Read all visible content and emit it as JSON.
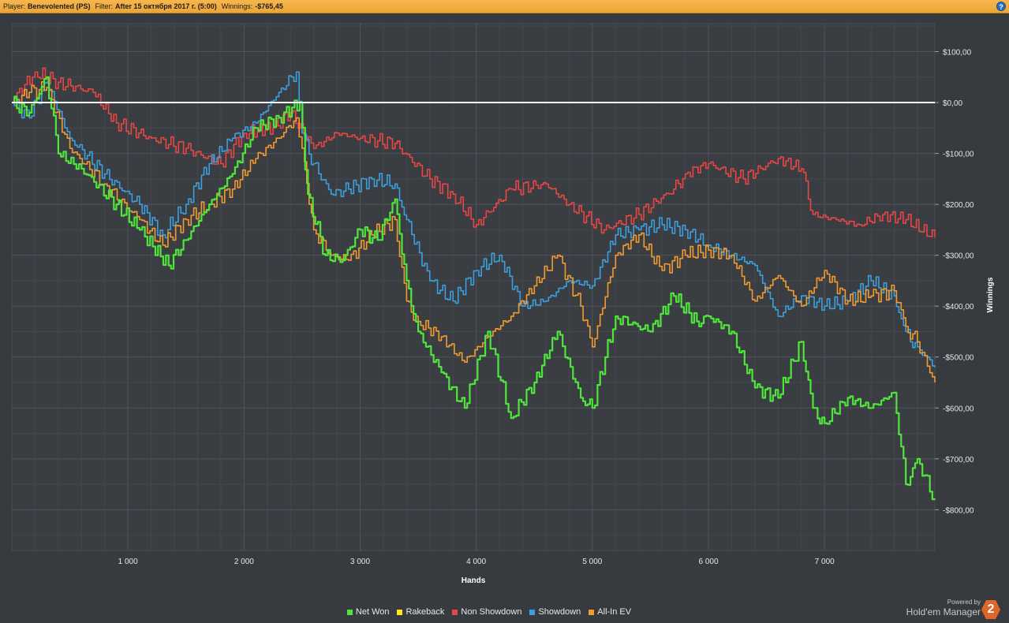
{
  "header": {
    "player_label": "Player:",
    "player_value": "Benevolented (PS)",
    "filter_label": "Filter:",
    "filter_value": "After 15 октября 2017 г. (5:00)",
    "winnings_label": "Winnings:",
    "winnings_value": "-$765,45",
    "help_glyph": "?"
  },
  "chart_data": {
    "type": "line",
    "xlabel": "Hands",
    "ylabel": "Winnings",
    "xlim": [
      0,
      7950
    ],
    "ylim": [
      -880,
      155
    ],
    "x_ticks": [
      1000,
      2000,
      3000,
      4000,
      5000,
      6000,
      7000
    ],
    "x_tick_labels": [
      "1 000",
      "2 000",
      "3 000",
      "4 000",
      "5 000",
      "6 000",
      "7 000"
    ],
    "y_ticks": [
      100,
      0,
      -100,
      -200,
      -300,
      -400,
      -500,
      -600,
      -700,
      -800
    ],
    "y_tick_labels": [
      "$100,00",
      "$0,00",
      "-$100,00",
      "-$200,00",
      "-$300,00",
      "-$400,00",
      "-$500,00",
      "-$600,00",
      "-$700,00",
      "-$800,00"
    ],
    "grid": true,
    "zero_line": true,
    "legend_position": "bottom",
    "series": [
      {
        "name": "Net Won",
        "color": "#4ee63a",
        "x": [
          0,
          150,
          300,
          400,
          600,
          900,
          1100,
          1350,
          1500,
          1700,
          1900,
          2100,
          2300,
          2480,
          2550,
          2700,
          2850,
          3000,
          3150,
          3300,
          3400,
          3500,
          3700,
          3900,
          4100,
          4300,
          4500,
          4700,
          4900,
          5000,
          5200,
          5500,
          5700,
          5900,
          6000,
          6200,
          6400,
          6600,
          6800,
          6900,
          7000,
          7200,
          7400,
          7600,
          7700,
          7800,
          7950
        ],
        "y": [
          0,
          -20,
          50,
          -100,
          -130,
          -200,
          -250,
          -320,
          -270,
          -200,
          -140,
          -50,
          -30,
          0,
          -180,
          -300,
          -310,
          -250,
          -270,
          -190,
          -350,
          -450,
          -530,
          -600,
          -450,
          -620,
          -550,
          -450,
          -580,
          -600,
          -420,
          -450,
          -380,
          -430,
          -420,
          -450,
          -560,
          -580,
          -470,
          -600,
          -630,
          -580,
          -600,
          -570,
          -750,
          -700,
          -780
        ]
      },
      {
        "name": "Rakeback",
        "color": "#ffe81a",
        "x": [
          0,
          7950
        ],
        "y": [
          0,
          0
        ]
      },
      {
        "name": "Non Showdown",
        "color": "#e84545",
        "x": [
          0,
          200,
          400,
          700,
          900,
          1200,
          1500,
          1800,
          2000,
          2250,
          2400,
          2600,
          2800,
          3000,
          3300,
          3600,
          3800,
          4000,
          4300,
          4600,
          4800,
          5100,
          5400,
          5700,
          5800,
          6000,
          6300,
          6600,
          6800,
          6900,
          7100,
          7300,
          7500,
          7700,
          7950
        ],
        "y": [
          0,
          60,
          40,
          20,
          -40,
          -70,
          -90,
          -120,
          -60,
          -50,
          -20,
          -90,
          -60,
          -70,
          -80,
          -150,
          -180,
          -240,
          -170,
          -160,
          -200,
          -250,
          -220,
          -170,
          -140,
          -120,
          -150,
          -110,
          -130,
          -220,
          -230,
          -240,
          -220,
          -230,
          -265
        ]
      },
      {
        "name": "Showdown",
        "color": "#3c9fdd",
        "x": [
          0,
          150,
          300,
          500,
          800,
          1100,
          1300,
          1500,
          1700,
          1900,
          2100,
          2300,
          2450,
          2500,
          2600,
          2750,
          2900,
          3100,
          3300,
          3400,
          3600,
          3800,
          4000,
          4200,
          4400,
          4600,
          4800,
          5000,
          5200,
          5400,
          5600,
          5800,
          6000,
          6200,
          6400,
          6600,
          6800,
          7000,
          7200,
          7400,
          7600,
          7700,
          7800,
          7950
        ],
        "y": [
          0,
          -30,
          40,
          -70,
          -140,
          -200,
          -260,
          -200,
          -120,
          -70,
          -40,
          20,
          60,
          -60,
          -120,
          -180,
          -170,
          -150,
          -160,
          -230,
          -350,
          -390,
          -330,
          -300,
          -400,
          -390,
          -350,
          -360,
          -260,
          -250,
          -240,
          -250,
          -280,
          -300,
          -320,
          -420,
          -380,
          -400,
          -390,
          -350,
          -380,
          -450,
          -480,
          -520
        ]
      },
      {
        "name": "All-In EV",
        "color": "#f39a2f",
        "x": [
          0,
          150,
          300,
          500,
          800,
          1100,
          1300,
          1500,
          1700,
          1900,
          2100,
          2300,
          2450,
          2500,
          2600,
          2750,
          2900,
          3100,
          3300,
          3400,
          3500,
          3700,
          3900,
          4100,
          4300,
          4500,
          4700,
          4900,
          5000,
          5200,
          5400,
          5600,
          5800,
          6000,
          6200,
          6400,
          6600,
          6800,
          7000,
          7200,
          7400,
          7600,
          7700,
          7800,
          7950
        ],
        "y": [
          0,
          20,
          30,
          -90,
          -160,
          -230,
          -280,
          -230,
          -200,
          -170,
          -110,
          -70,
          -30,
          -90,
          -250,
          -300,
          -310,
          -260,
          -230,
          -390,
          -430,
          -460,
          -510,
          -460,
          -420,
          -360,
          -300,
          -400,
          -480,
          -300,
          -260,
          -330,
          -300,
          -290,
          -300,
          -390,
          -340,
          -400,
          -330,
          -390,
          -380,
          -370,
          -440,
          -470,
          -550
        ]
      }
    ]
  },
  "brand": {
    "powered": "Powered by",
    "name": "Hold'em Manager",
    "logo": "2"
  }
}
